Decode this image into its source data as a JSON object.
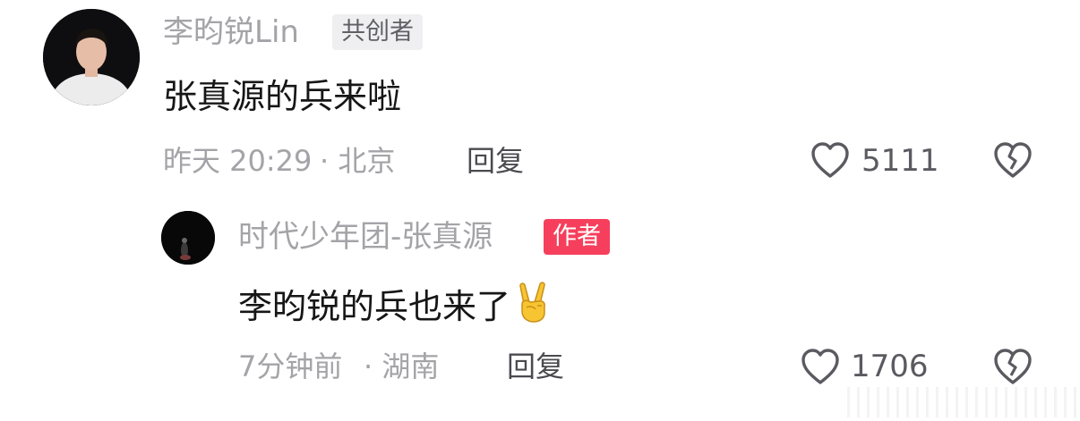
{
  "comments": [
    {
      "username": "李昀锐Lin",
      "tag": "共创者",
      "text": "张真源的兵来啦",
      "time": "昨天 20:29",
      "location": "· 北京",
      "reply_label": "回复",
      "like_count": "5111"
    },
    {
      "username": "时代少年团-张真源",
      "tag": "作者",
      "text": "李昀锐的兵也来了",
      "emoji": "victory-hand-emoji",
      "time": "7分钟前",
      "location": "· 湖南",
      "reply_label": "回复",
      "like_count": "1706"
    }
  ],
  "colors": {
    "username": "#a4a4a8",
    "author_tag": "#f63f5c",
    "cocreator_tag_bg": "#efeff1",
    "text": "#161616"
  },
  "icons": {
    "like": "heart-outline-icon",
    "dislike": "broken-heart-icon"
  }
}
